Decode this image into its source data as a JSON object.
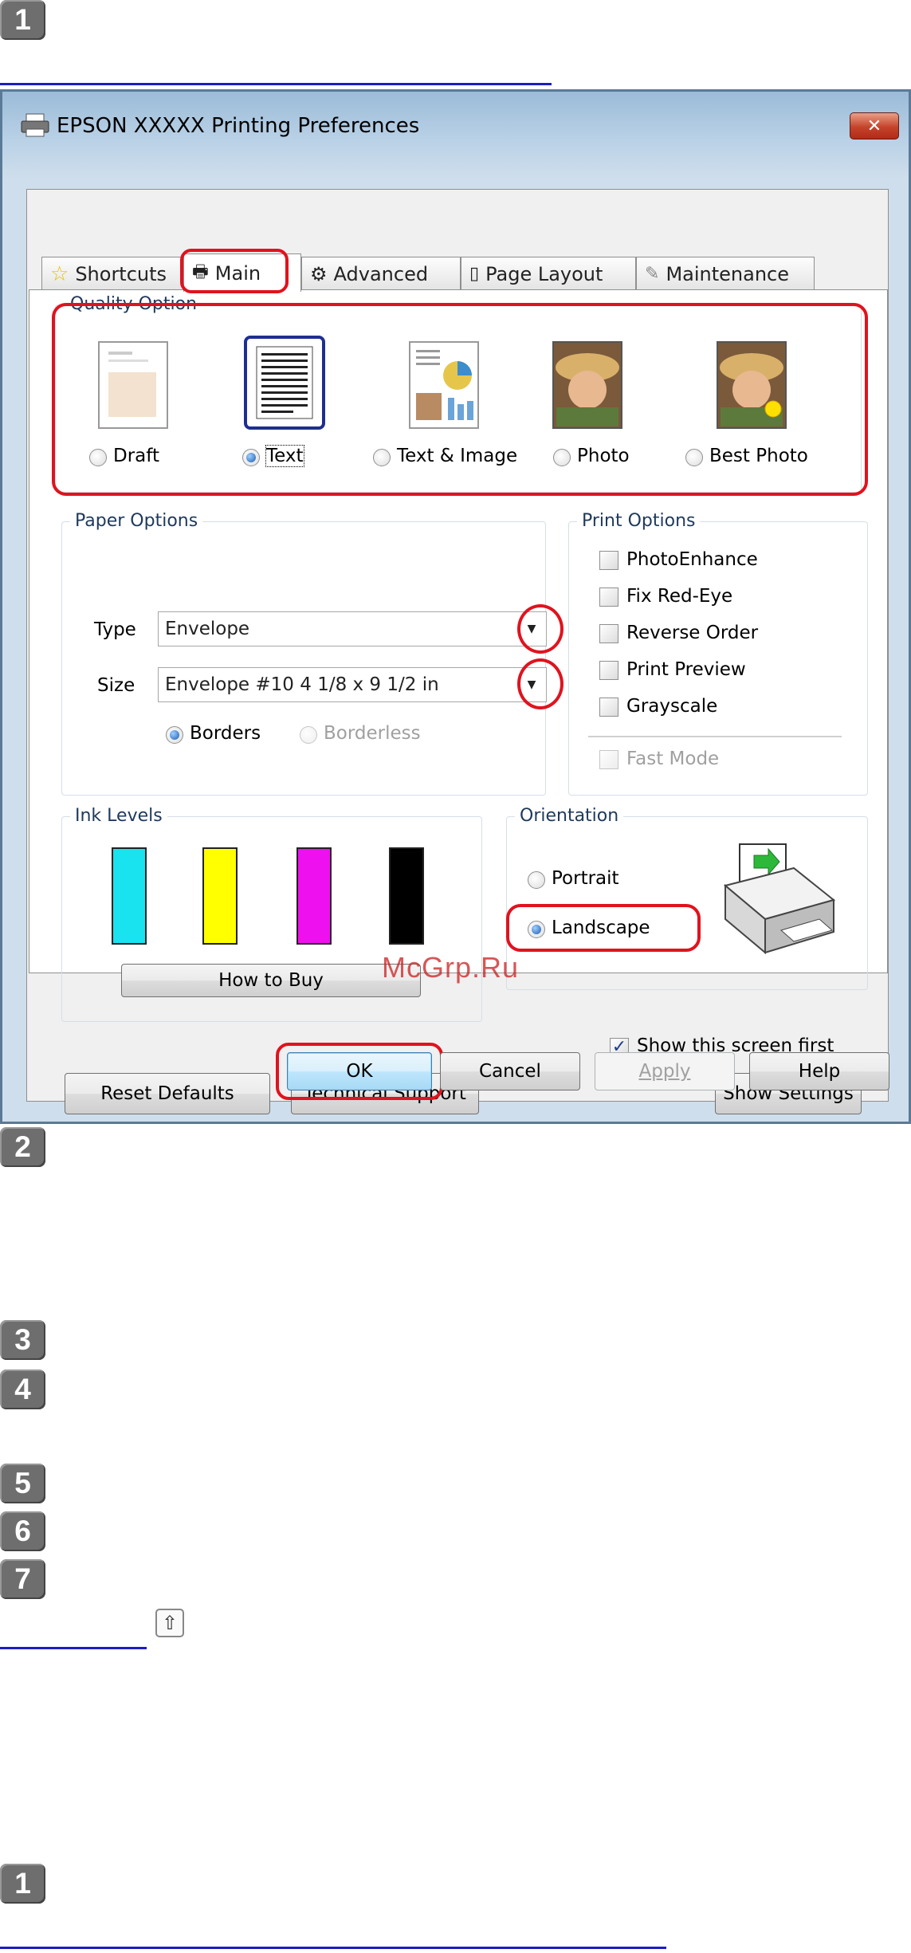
{
  "steps": [
    "1",
    "2",
    "3",
    "4",
    "5",
    "6",
    "7",
    "1"
  ],
  "window": {
    "title": "EPSON XXXXX  Printing Preferences",
    "close_label": "✕"
  },
  "tabs": [
    {
      "label": "Shortcuts",
      "icon": "star-icon"
    },
    {
      "label": "Main",
      "icon": "printer-icon",
      "active": true
    },
    {
      "label": "Advanced",
      "icon": "gear-icon"
    },
    {
      "label": "Page Layout",
      "icon": "page-icon"
    },
    {
      "label": "Maintenance",
      "icon": "wrench-icon"
    }
  ],
  "quality": {
    "title": "Quality Option",
    "options": [
      {
        "label": "Draft",
        "selected": false
      },
      {
        "label": "Text",
        "selected": true
      },
      {
        "label": "Text & Image",
        "selected": false
      },
      {
        "label": "Photo",
        "selected": false
      },
      {
        "label": "Best Photo",
        "selected": false
      }
    ]
  },
  "paper": {
    "title": "Paper Options",
    "type_label": "Type",
    "type_value": "Envelope",
    "size_label": "Size",
    "size_value": "Envelope #10 4 1/8 x 9 1/2 in",
    "borders_label": "Borders",
    "borderless_label": "Borderless"
  },
  "print_options": {
    "title": "Print Options",
    "items": [
      {
        "label": "PhotoEnhance",
        "checked": false
      },
      {
        "label": "Fix Red-Eye",
        "checked": false
      },
      {
        "label": "Reverse Order",
        "checked": false
      },
      {
        "label": "Print Preview",
        "checked": false
      },
      {
        "label": "Grayscale",
        "checked": false
      }
    ],
    "fast_mode": "Fast Mode"
  },
  "ink": {
    "title": "Ink Levels",
    "colors": [
      "#19e3ee",
      "#ffff00",
      "#ee10ee",
      "#000000"
    ],
    "how_to_buy": "How to Buy"
  },
  "orientation": {
    "title": "Orientation",
    "portrait": "Portrait",
    "landscape": "Landscape"
  },
  "show_first": "Show this screen first",
  "buttons": {
    "reset": "Reset Defaults",
    "support": "Technical Support",
    "show_settings": "Show Settings",
    "ok": "OK",
    "cancel": "Cancel",
    "apply": "Apply",
    "help": "Help"
  },
  "watermark": "McGrp.Ru",
  "back_icon": "⇧",
  "colors": {
    "highlight": "#e0131e",
    "link_rule": "#1c1cc4"
  }
}
